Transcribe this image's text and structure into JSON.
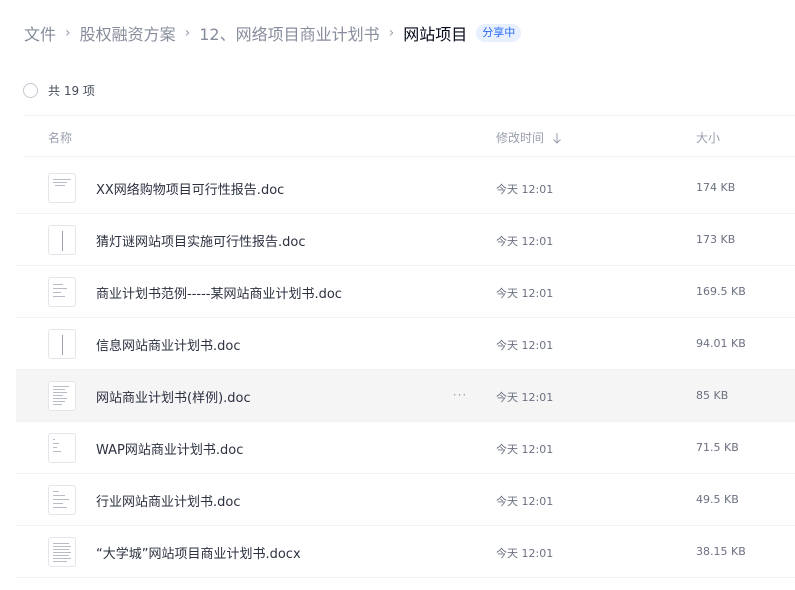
{
  "breadcrumb": {
    "items": [
      "文件",
      "股权融资方案",
      "12、网络项目商业计划书"
    ],
    "current": "网站项目",
    "badge": "分享中",
    "separator": "›"
  },
  "select_bar": {
    "count_label": "共 19 项"
  },
  "columns": {
    "name": "名称",
    "modified": "修改时间",
    "size": "大小"
  },
  "files": [
    {
      "name": "XX网络购物项目可行性报告.doc",
      "modified": "今天 12:01",
      "size": "174 KB",
      "icon": "doc-file-icon"
    },
    {
      "name": "猜灯谜网站项目实施可行性报告.doc",
      "modified": "今天 12:01",
      "size": "173 KB",
      "icon": "doc-file-icon"
    },
    {
      "name": "商业计划书范例-----某网站商业计划书.doc",
      "modified": "今天 12:01",
      "size": "169.5 KB",
      "icon": "doc-file-icon"
    },
    {
      "name": "信息网站商业计划书.doc",
      "modified": "今天 12:01",
      "size": "94.01 KB",
      "icon": "doc-file-icon"
    },
    {
      "name": "网站商业计划书(样例).doc",
      "modified": "今天 12:01",
      "size": "85 KB",
      "icon": "doc-file-icon",
      "hovered": true,
      "more": "···"
    },
    {
      "name": "WAP网站商业计划书.doc",
      "modified": "今天 12:01",
      "size": "71.5 KB",
      "icon": "doc-file-icon"
    },
    {
      "name": "行业网站商业计划书.doc",
      "modified": "今天 12:01",
      "size": "49.5 KB",
      "icon": "doc-file-icon"
    },
    {
      "name": "“大学城”网站项目商业计划书.docx",
      "modified": "今天 12:01",
      "size": "38.15 KB",
      "icon": "docx-file-icon"
    }
  ],
  "colors": {
    "accent": "#2a6cf6",
    "badge_bg": "#e8efff",
    "hover_row": "#f5f5f6",
    "text_dark": "#2c3140",
    "text_muted": "#9a9fae"
  }
}
